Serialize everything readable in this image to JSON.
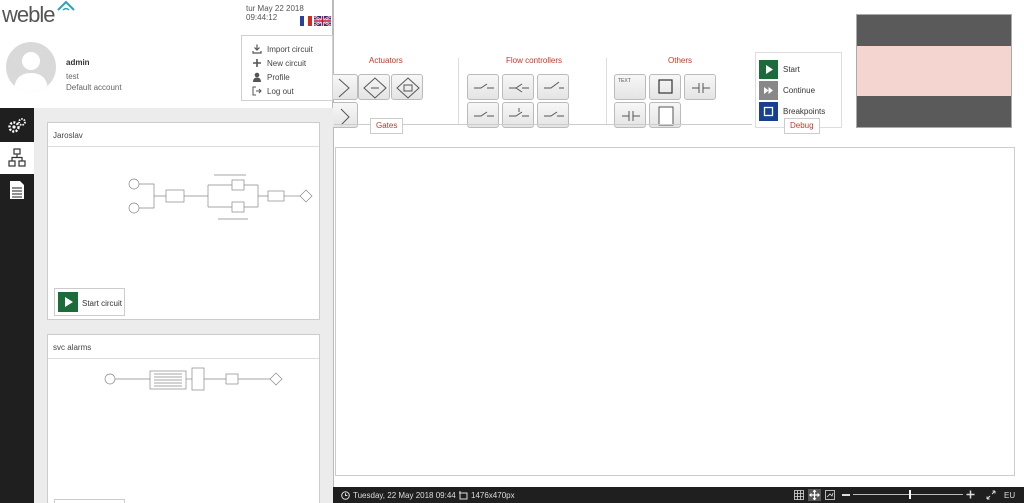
{
  "header": {
    "brand": "weble",
    "datetime": "tur May 22 2018 09:44:12"
  },
  "user": {
    "name": "admin",
    "subtitle": "test",
    "account": "Default account"
  },
  "user_menu": {
    "items": [
      {
        "label": "Import circuit",
        "icon": "import-icon"
      },
      {
        "label": "New circuit",
        "icon": "plus-icon"
      },
      {
        "label": "Profile",
        "icon": "user-icon"
      },
      {
        "label": "Log out",
        "icon": "logout-icon"
      }
    ]
  },
  "sidebar": {
    "items": [
      {
        "icon": "gears-icon"
      },
      {
        "icon": "hierarchy-icon"
      },
      {
        "icon": "document-icon"
      }
    ]
  },
  "circuits": [
    {
      "title": "Jaroslav",
      "button": "Start circuit"
    },
    {
      "title": "svc alarms"
    }
  ],
  "ribbon": {
    "groups": [
      "Actuators",
      "Flow controllers",
      "Others"
    ],
    "gates_label": "Gates",
    "debug_label": "Debug",
    "others_text_tile": "TEXT"
  },
  "debug": {
    "start": "Start",
    "continue": "Continue",
    "breakpoints": "Breakpoints"
  },
  "statusbar": {
    "datetime": "Tuesday, 22 May 2018 09:44",
    "size": "1476x470px",
    "locale": "EU"
  },
  "colors": {
    "accent_red": "#c0392b",
    "start_green": "#1d6b3a",
    "continue_gray": "#888888",
    "breakpoints_blue": "#1a3f8f",
    "dark_bar": "#1f1f1f",
    "preview_band_dark": "#5a5a5a",
    "preview_band_pink": "#f5d5d0"
  }
}
